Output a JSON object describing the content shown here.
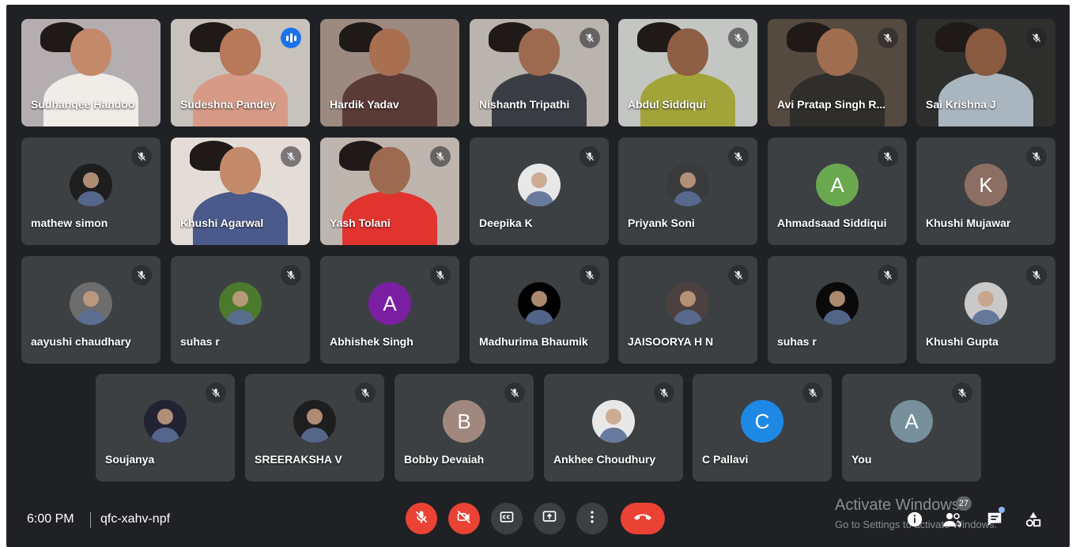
{
  "colors": {
    "background": "#202124",
    "tile": "#3c4043",
    "speaking_border": "#8ab4f8",
    "danger": "#ea4335",
    "control_gray": "#3c4043"
  },
  "participants": [
    {
      "name": "Sudhangee Handoo",
      "video": true,
      "muted": false
    },
    {
      "name": "Sudeshna Pandey",
      "video": true,
      "speaking": true
    },
    {
      "name": "Hardik Yadav",
      "video": true,
      "muted": false
    },
    {
      "name": "Nishanth Tripathi",
      "video": true,
      "muted": true
    },
    {
      "name": "Abdul Siddiqui",
      "video": true,
      "muted": true
    },
    {
      "name": "Avi Pratap Singh R...",
      "video": true,
      "muted": true
    },
    {
      "name": "Sai Krishna J",
      "video": true,
      "muted": true
    },
    {
      "name": "mathew simon",
      "avatar_type": "photo",
      "muted": true
    },
    {
      "name": "Khushi Agarwal",
      "video": true,
      "muted": true
    },
    {
      "name": "Yash Tolani",
      "video": true,
      "muted": true
    },
    {
      "name": "Deepika K",
      "avatar_type": "photo",
      "muted": true
    },
    {
      "name": "Priyank Soni",
      "avatar_type": "photo",
      "muted": true
    },
    {
      "name": "Ahmadsaad Siddiqui",
      "avatar_type": "letter",
      "letter": "A",
      "color": "#6aa84f",
      "muted": true
    },
    {
      "name": "Khushi Mujawar",
      "avatar_type": "letter",
      "letter": "K",
      "color": "#8d6e63",
      "muted": true
    },
    {
      "name": "aayushi chaudhary",
      "avatar_type": "photo",
      "muted": true
    },
    {
      "name": "suhas r",
      "avatar_type": "photo",
      "muted": true
    },
    {
      "name": "Abhishek Singh",
      "avatar_type": "letter",
      "letter": "A",
      "color": "#7b1fa2",
      "muted": true
    },
    {
      "name": "Madhurima Bhaumik",
      "avatar_type": "photo",
      "muted": true
    },
    {
      "name": "JAISOORYA H N",
      "avatar_type": "photo",
      "muted": true
    },
    {
      "name": "suhas r",
      "avatar_type": "photo",
      "muted": true
    },
    {
      "name": "Khushi Gupta",
      "avatar_type": "photo",
      "muted": true
    },
    {
      "name": "Soujanya",
      "avatar_type": "photo",
      "muted": true
    },
    {
      "name": "SREERAKSHA V",
      "avatar_type": "photo",
      "muted": true
    },
    {
      "name": "Bobby Devaiah",
      "avatar_type": "letter",
      "letter": "B",
      "color": "#a1887f",
      "muted": true
    },
    {
      "name": "Ankhee Choudhury",
      "avatar_type": "photo",
      "muted": true
    },
    {
      "name": "C Pallavi",
      "avatar_type": "letter",
      "letter": "C",
      "color": "#1e88e5",
      "muted": true
    },
    {
      "name": "You",
      "avatar_type": "letter",
      "letter": "A",
      "color": "#78909c",
      "muted": true
    }
  ],
  "bottom_bar": {
    "time": "6:00 PM",
    "separator": "|",
    "meeting_code": "qfc-xahv-npf",
    "participant_count": "27",
    "controls": [
      {
        "icon": "mic-off-icon",
        "state": "off"
      },
      {
        "icon": "camera-off-icon",
        "state": "off"
      },
      {
        "icon": "captions-icon",
        "state": "off"
      },
      {
        "icon": "present-screen-icon"
      },
      {
        "icon": "more-options-icon"
      },
      {
        "icon": "end-call-icon"
      }
    ]
  },
  "watermark": {
    "title": "Activate Windows",
    "subtitle": "Go to Settings to activate Windows."
  }
}
